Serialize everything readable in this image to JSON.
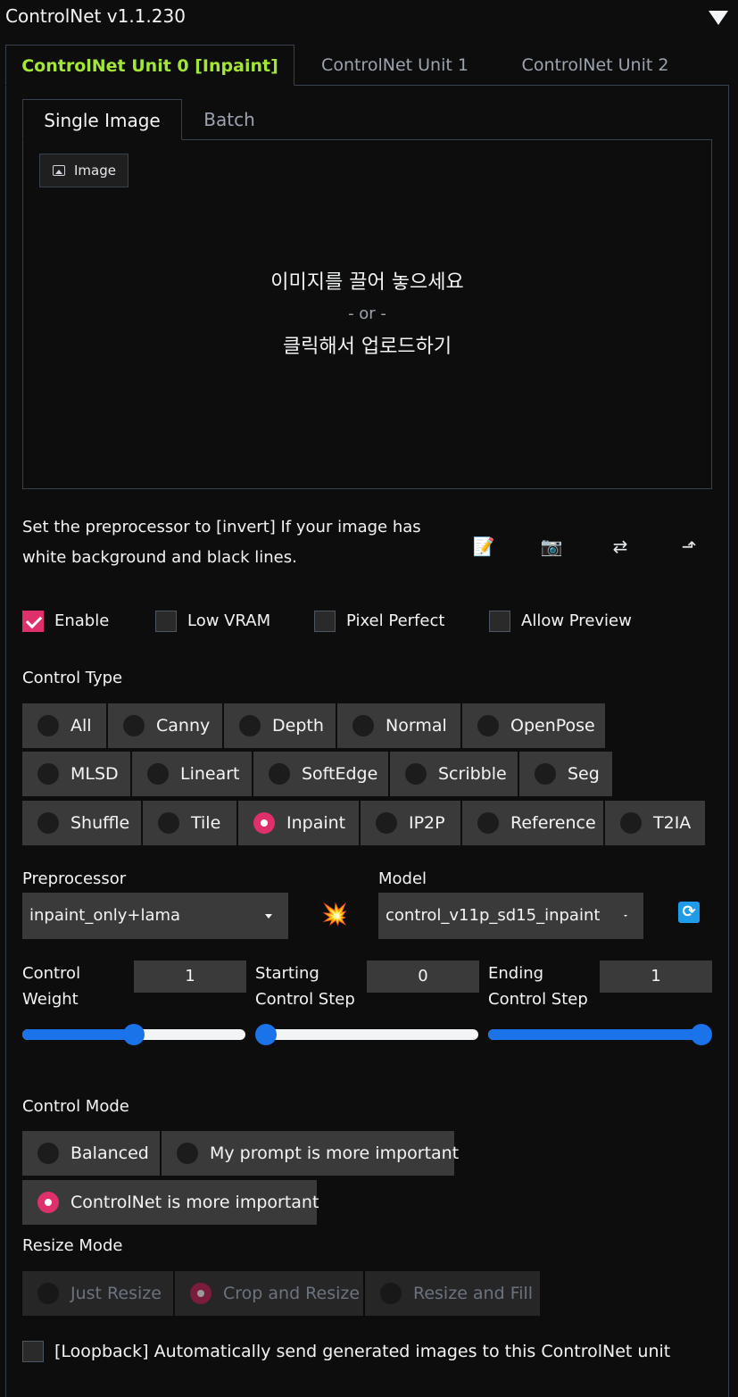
{
  "header": {
    "title": "ControlNet v1.1.230"
  },
  "unit_tabs": [
    "ControlNet Unit 0 [Inpaint]",
    "ControlNet Unit 1",
    "ControlNet Unit 2"
  ],
  "image_tabs": [
    "Single Image",
    "Batch"
  ],
  "upload": {
    "label": "Image",
    "drop_text": "이미지를 끌어 놓으세요",
    "or_text": "- or -",
    "click_text": "클릭해서 업로드하기"
  },
  "hint": "Set the preprocessor to [invert] If your image has white background and black lines.",
  "tools": {
    "edit": "📝",
    "camera": "📷",
    "swap": "⇄",
    "send": "⬏"
  },
  "options": {
    "enable": "Enable",
    "low_vram": "Low VRAM",
    "pixel_perfect": "Pixel Perfect",
    "allow_preview": "Allow Preview"
  },
  "control_type": {
    "label": "Control Type",
    "selected": "Inpaint",
    "items": [
      "All",
      "Canny",
      "Depth",
      "Normal",
      "OpenPose",
      "MLSD",
      "Lineart",
      "SoftEdge",
      "Scribble",
      "Seg",
      "Shuffle",
      "Tile",
      "Inpaint",
      "IP2P",
      "Reference",
      "T2IA"
    ]
  },
  "preprocessor": {
    "label": "Preprocessor",
    "value": "inpaint_only+lama",
    "run_icon": "💥"
  },
  "model": {
    "label": "Model",
    "value": "control_v11p_sd15_inpaint",
    "refresh_icon": "🔄"
  },
  "sliders": {
    "weight": {
      "label_1": "Control",
      "label_2": "Weight",
      "value": "1",
      "fraction": 0.5
    },
    "start": {
      "label_1": "Starting",
      "label_2": "Control Step",
      "value": "0",
      "fraction": 0.0
    },
    "end": {
      "label_1": "Ending",
      "label_2": "Control Step",
      "value": "1",
      "fraction": 1.0
    }
  },
  "control_mode": {
    "label": "Control Mode",
    "selected": "ControlNet is more important",
    "items": [
      "Balanced",
      "My prompt is more important",
      "ControlNet is more important"
    ]
  },
  "resize_mode": {
    "label": "Resize Mode",
    "selected": "Crop and Resize",
    "items": [
      "Just Resize",
      "Crop and Resize",
      "Resize and Fill"
    ]
  },
  "loopback": "[Loopback] Automatically send generated images to this ControlNet unit",
  "colors": {
    "accent_pink": "#e0306c",
    "active_tab": "#a3e635",
    "slider_blue": "#1a73e8"
  }
}
